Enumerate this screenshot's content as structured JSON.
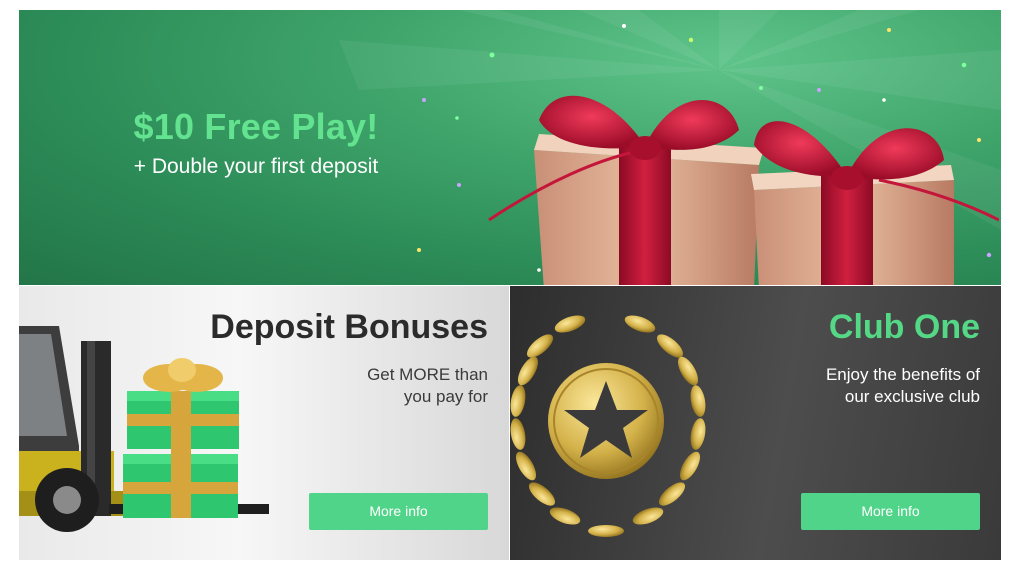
{
  "hero": {
    "title": "$10 Free Play!",
    "subtitle": "+ Double your first deposit",
    "colors": {
      "background": "#2f9460",
      "title": "#63e28f",
      "ribbon": "#c4163a",
      "box": "#d9a98c"
    }
  },
  "promos": [
    {
      "title": "Deposit Bonuses",
      "subtitle_line1": "Get MORE than",
      "subtitle_line2": "you pay for",
      "button_label": "More info",
      "colors": {
        "background": "#ececec",
        "title": "#2b2b2b",
        "button": "#50d489",
        "gift": "#2ec76f",
        "ribbon": "#d6a63c"
      }
    },
    {
      "title": "Club One",
      "subtitle_line1": "Enjoy the benefits of",
      "subtitle_line2": "our exclusive club",
      "button_label": "More info",
      "colors": {
        "background": "#3a3a3a",
        "title": "#55d886",
        "button": "#50d489",
        "emblem": "#d4b24a"
      }
    }
  ],
  "icons": [
    "gift-boxes-icon",
    "forklift-icon",
    "star-laurel-emblem-icon"
  ]
}
